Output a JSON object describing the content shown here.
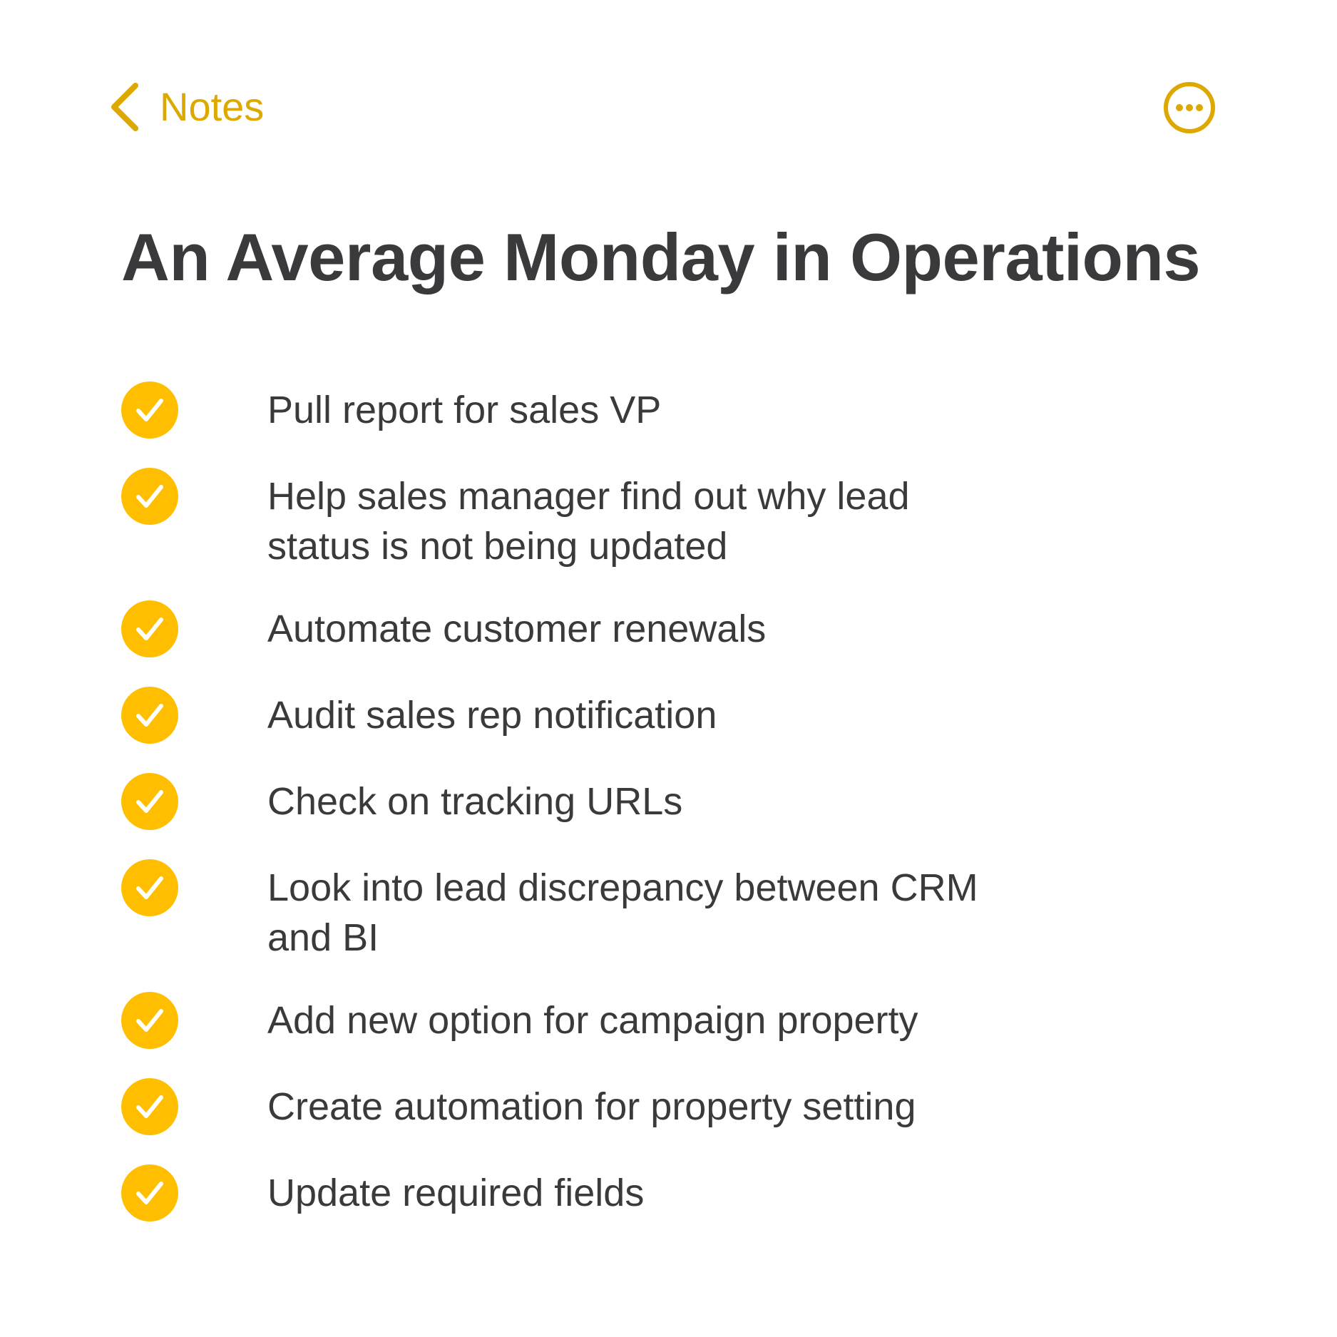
{
  "nav": {
    "back_label": "Notes",
    "back_icon": "chevron-left-icon",
    "more_icon": "ellipsis-circle-icon"
  },
  "note": {
    "title": "An Average Monday in Operations",
    "items": [
      {
        "text": "Pull report for sales VP",
        "checked": true
      },
      {
        "text": "Help sales manager find out why lead status is not being updated",
        "checked": true
      },
      {
        "text": "Automate customer renewals",
        "checked": true
      },
      {
        "text": "Audit sales rep notification",
        "checked": true
      },
      {
        "text": "Check on tracking URLs",
        "checked": true
      },
      {
        "text": "Look into lead discrepancy between CRM and BI",
        "checked": true
      },
      {
        "text": "Add new option for campaign property",
        "checked": true
      },
      {
        "text": "Create automation for property setting",
        "checked": true
      },
      {
        "text": "Update required fields",
        "checked": true
      }
    ]
  },
  "colors": {
    "accent": "#FFBF00",
    "accent_text": "#DDA800",
    "text": "#3A3A3C",
    "background": "#FFFFFF",
    "check_mark": "#FFFFFF"
  }
}
